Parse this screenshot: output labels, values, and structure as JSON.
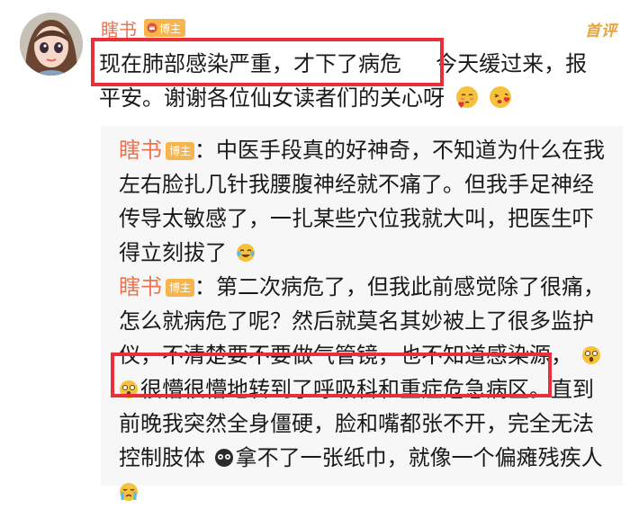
{
  "post": {
    "author": "瞎书",
    "badge": "博主",
    "top_label": "首评",
    "line1_highlight": "现在肺部感染严重，才下了病危",
    "line1_rest": "今天缓过来，报",
    "line2": "平安。谢谢各位仙女读者们的关心呀",
    "emoji_1": "blush-heart-emoji",
    "emoji_2": "kiss-emoji"
  },
  "replies": [
    {
      "author": "瞎书",
      "badge": "博主",
      "lines": [
        "：中医手段真的好神奇，不知道为什么在我",
        "左右脸扎几针我腰腹神经就不痛了。但我手足神经",
        "传导太敏感了，一扎某些穴位我就大叫，把医生吓",
        "得立刻拔了"
      ],
      "trailing_emoji": "laugh-cry-emoji"
    },
    {
      "author": "瞎书",
      "badge": "博主",
      "lines": [
        "：第二次病危了，但我此前感觉除了很痛，",
        "怎么就病危了呢？然后就莫名其妙被上了很多监护",
        "仪，不清楚要不要做气管镜，也不知道感染源，"
      ],
      "highlight": "很懵很懵地转到了呼吸科和重症危急病区",
      "after_highlight": "。直到",
      "lines2": [
        "前晚我突然全身僵硬，脸和嘴都张不开，完全无法",
        "控制肢体"
      ],
      "line_tail": "拿不了一张纸巾，就像一个偏瘫残疾人"
    }
  ]
}
